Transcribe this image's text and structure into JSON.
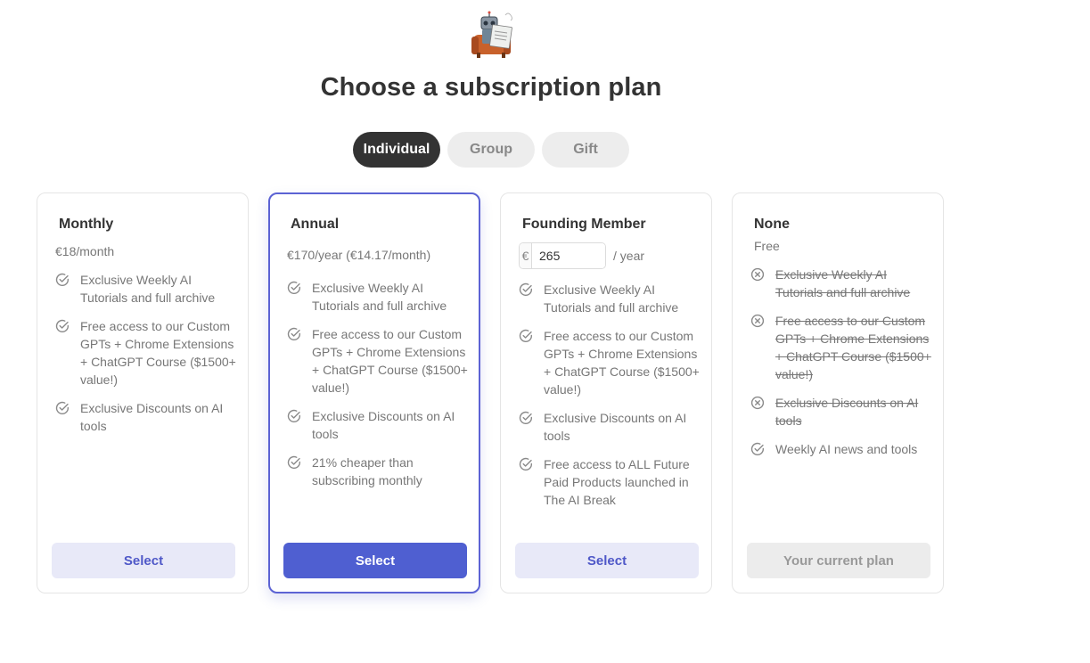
{
  "header": {
    "title": "Choose a subscription plan"
  },
  "tabs": [
    {
      "label": "Individual",
      "active": true
    },
    {
      "label": "Group",
      "active": false
    },
    {
      "label": "Gift",
      "active": false
    }
  ],
  "colors": {
    "accent": "#4f5fd1",
    "accent_light": "#e8e9f8",
    "active_tab": "#333333"
  },
  "plans": [
    {
      "title": "Monthly",
      "price": "€18/month",
      "features": [
        {
          "icon": "check-circle-icon",
          "text": "Exclusive Weekly AI Tutorials and full archive"
        },
        {
          "icon": "check-circle-icon",
          "text": "Free access to our Custom GPTs + Chrome Extensions + ChatGPT Course ($1500+ value!)"
        },
        {
          "icon": "check-circle-icon",
          "text": "Exclusive Discounts on AI tools"
        }
      ],
      "button": "Select"
    },
    {
      "title": "Annual",
      "price": "€170/year (€14.17/month)",
      "features": [
        {
          "icon": "check-circle-icon",
          "text": "Exclusive Weekly AI Tutorials and full archive"
        },
        {
          "icon": "check-circle-icon",
          "text": "Free access to our Custom GPTs + Chrome Extensions + ChatGPT Course ($1500+ value!)"
        },
        {
          "icon": "check-circle-icon",
          "text": "Exclusive Discounts on AI tools"
        },
        {
          "icon": "check-circle-icon",
          "text": "21% cheaper than subscribing monthly"
        }
      ],
      "button": "Select"
    },
    {
      "title": "Founding Member",
      "amount": {
        "currency": "€",
        "value": "265",
        "suffix": "/ year"
      },
      "features": [
        {
          "icon": "check-circle-icon",
          "text": "Exclusive Weekly AI Tutorials and full archive"
        },
        {
          "icon": "check-circle-icon",
          "text": "Free access to our Custom GPTs + Chrome Extensions + ChatGPT Course ($1500+ value!)"
        },
        {
          "icon": "check-circle-icon",
          "text": "Exclusive Discounts on AI tools"
        },
        {
          "icon": "check-circle-icon",
          "text": "Free access to ALL Future Paid Products launched in The AI Break"
        }
      ],
      "button": "Select"
    },
    {
      "title": "None",
      "price": "Free",
      "features": [
        {
          "icon": "x-circle-icon",
          "text": "Exclusive Weekly AI Tutorials and full archive"
        },
        {
          "icon": "x-circle-icon",
          "text": "Free access to our Custom GPTs + Chrome Extensions + ChatGPT Course ($1500+ value!)"
        },
        {
          "icon": "x-circle-icon",
          "text": "Exclusive Discounts on AI tools"
        },
        {
          "icon": "check-circle-icon",
          "text": "Weekly AI news and tools"
        }
      ],
      "button": "Your current plan"
    }
  ]
}
